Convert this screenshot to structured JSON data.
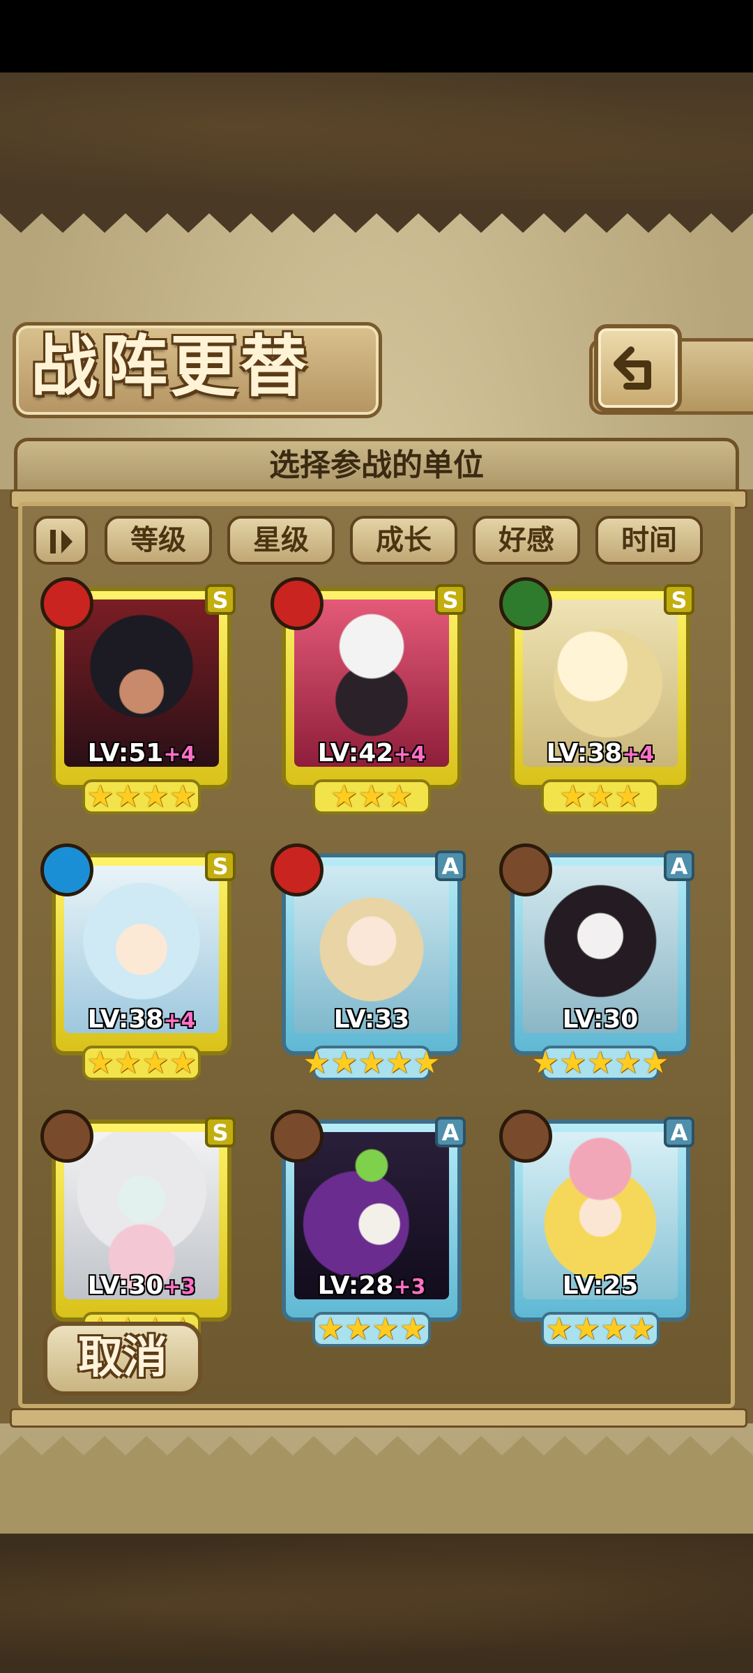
{
  "screen": {
    "title": "战阵更替",
    "subtitle": "选择参战的单位"
  },
  "filters": {
    "sort_icon": "sort-toggle-icon",
    "tabs": [
      "等级",
      "星级",
      "成长",
      "好感",
      "时间"
    ]
  },
  "cancel_label": "取消",
  "units": [
    {
      "rank": "S",
      "element": "fire",
      "level": "LV:51",
      "bonus": "+4",
      "stars": "★★★★",
      "frame": "gold"
    },
    {
      "rank": "S",
      "element": "fire",
      "level": "LV:42",
      "bonus": "+4",
      "stars": "★★★",
      "frame": "gold"
    },
    {
      "rank": "S",
      "element": "wood",
      "level": "LV:38",
      "bonus": "+4",
      "stars": "★★★",
      "frame": "gold"
    },
    {
      "rank": "S",
      "element": "water",
      "level": "LV:38",
      "bonus": "+4",
      "stars": "★★★★",
      "frame": "gold"
    },
    {
      "rank": "A",
      "element": "fire",
      "level": "LV:33",
      "bonus": "",
      "stars": "★★★★★",
      "frame": "blue"
    },
    {
      "rank": "A",
      "element": "earth",
      "level": "LV:30",
      "bonus": "",
      "stars": "★★★★★",
      "frame": "blue"
    },
    {
      "rank": "S",
      "element": "earth",
      "level": "LV:30",
      "bonus": "+3",
      "stars": "★★★★",
      "frame": "gold"
    },
    {
      "rank": "A",
      "element": "earth",
      "level": "LV:28",
      "bonus": "+3",
      "stars": "★★★★",
      "frame": "blue"
    },
    {
      "rank": "A",
      "element": "earth",
      "level": "LV:25",
      "bonus": "",
      "stars": "★★★★",
      "frame": "blue"
    }
  ],
  "colors": {
    "fire": "#c9241f",
    "wood": "#2f7b2e",
    "water": "#1b8fd6",
    "earth": "#7a4a2c"
  }
}
